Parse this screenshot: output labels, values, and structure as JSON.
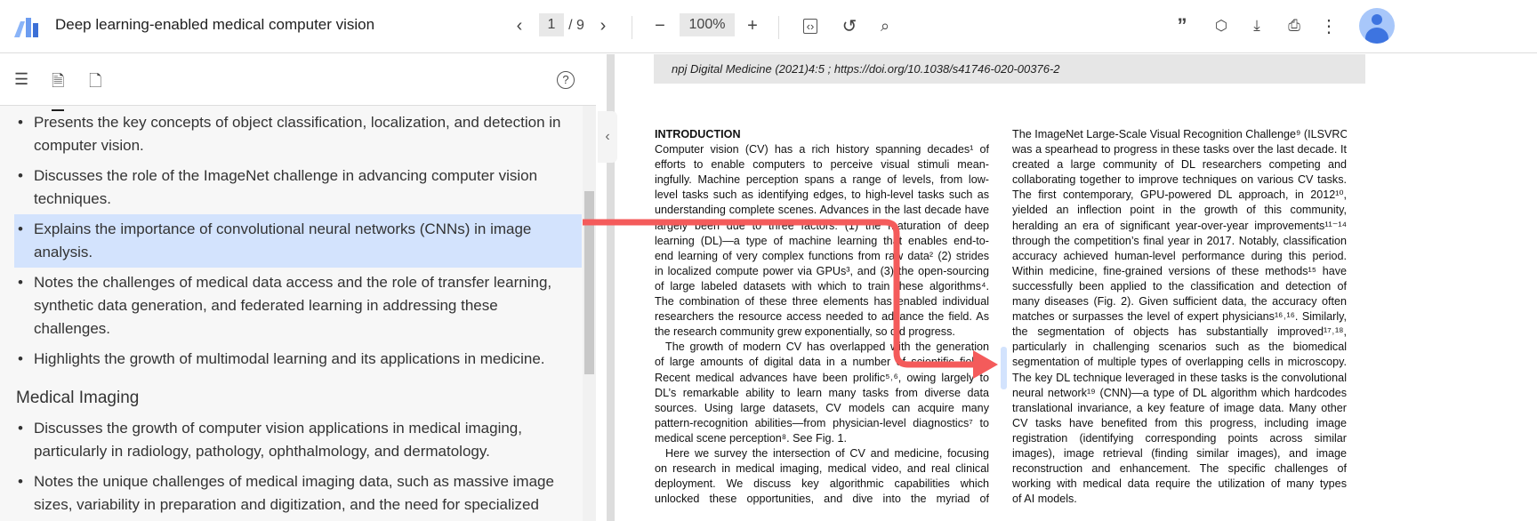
{
  "toolbar": {
    "title": "Deep learning-enabled medical computer vision",
    "page_current": "1",
    "page_total": "/ 9",
    "zoom": "100%"
  },
  "left_panel": {
    "items": [
      "Presents the key concepts of object classification, localization, and detection in computer vision.",
      "Discusses the role of the ImageNet challenge in advancing computer vision techniques.",
      "Explains the importance of convolutional neural networks (CNNs) in image analysis.",
      "Notes the challenges of medical data access and the role of transfer learning, synthetic data generation, and federated learning in addressing these challenges.",
      "Highlights the growth of multimodal learning and its applications in medicine."
    ],
    "section": "Medical Imaging",
    "section_items": [
      "Discusses the growth of computer vision applications in medical imaging, particularly in radiology, pathology, ophthalmology, and dermatology.",
      "Notes the unique challenges of medical imaging data, such as massive image sizes, variability in preparation and digitization, and the need for specialized deep learning models."
    ]
  },
  "pdf": {
    "citation": "npj Digital Medicine (2021)4:5 ; https://doi.org/10.1038/s41746-020-00376-2",
    "heading": "INTRODUCTION",
    "left_lines": [
      "Computer vision (CV) has a rich history spanning decades¹ of",
      "efforts to enable computers to perceive visual stimuli mean-",
      "ingfully. Machine perception spans a range of levels, from low-",
      "level tasks such as identifying edges, to high-level tasks such as",
      "understanding complete scenes. Advances in the last decade have",
      "largely been due to three factors: (1) the maturation of deep",
      "learning (DL)—a type of machine learning that enables end-to-",
      "end learning of very complex functions from raw data² (2) strides",
      "in localized compute power via GPUs³, and (3) the open-sourcing",
      "of large labeled datasets with which to train these algorithms⁴.",
      "The combination of these three elements has enabled individual",
      "researchers the resource access needed to advance the field. As",
      "the research community grew exponentially, so did progress.",
      "The growth of modern CV has overlapped with the generation",
      "of large amounts of digital data in a number of scientific fields.",
      "Recent medical advances have been prolific⁵˒⁶, owing largely to",
      "DL’s remarkable ability to learn many tasks from diverse data",
      "sources. Using large datasets, CV models can acquire many",
      "pattern-recognition abilities—from physician-level diagnostics⁷ to",
      "medical scene perception⁸. See Fig. 1.",
      "Here we survey the intersection of CV and medicine, focusing",
      "on research in medical imaging, medical video, and real clinical",
      "deployment. We discuss key algorithmic capabilities which",
      "unlocked these opportunities, and dive into the myriad of"
    ],
    "right_lines": [
      "The ImageNet Large-Scale Visual Recognition Challenge⁹ (ILSVRC)",
      "was a spearhead to progress in these tasks over the last decade. It",
      "created a large community of DL researchers competing and",
      "collaborating together to improve techniques on various CV tasks.",
      "The first contemporary, GPU-powered DL approach, in 2012¹⁰,",
      "yielded an inflection point in the growth of this community,",
      "heralding an era of significant year-over-year improvements¹¹⁻¹⁴",
      "through the competition’s final year in 2017. Notably, classification",
      "accuracy achieved human-level performance during this period.",
      "Within medicine, fine-grained versions of these methods¹⁵ have",
      "successfully been applied to the classification and detection of",
      "many diseases (Fig. 2). Given sufficient data, the accuracy often",
      "matches or surpasses the level of expert physicians¹⁶˒¹⁶. Similarly,",
      "the segmentation of objects has substantially improved¹⁷˒¹⁸,",
      "particularly in challenging scenarios such as the biomedical",
      "segmentation of multiple types of overlapping cells in microscopy.",
      "The key DL technique leveraged in these tasks is the convolutional",
      "neural network¹⁹ (CNN)—a type of DL algorithm which hardcodes",
      "translational invariance, a key feature of image data. Many other",
      "CV tasks have benefited from this progress, including image",
      "registration (identifying corresponding points across similar",
      "images), image retrieval (finding similar images), and image",
      "reconstruction and enhancement. The specific challenges of",
      "working with medical data require the utilization of many types",
      "of AI models."
    ]
  },
  "colors": {
    "highlight": "#d3e3fd",
    "arrow": "#f45b5b",
    "logo_light": "#8ab4f8",
    "logo_dark": "#3b6fd6"
  }
}
